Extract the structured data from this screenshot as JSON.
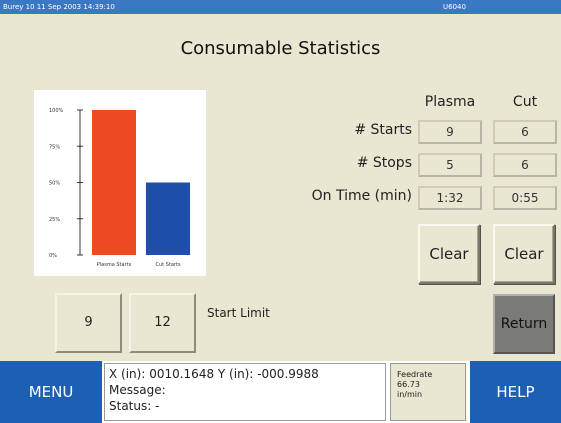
{
  "titlebar": {
    "left": "Burey 10   11 Sep 2003 14:39:10",
    "right": "U6040"
  },
  "page_title": "Consumable Statistics",
  "chart_data": {
    "type": "bar",
    "categories": [
      "Plasma Starts",
      "Cut Starts"
    ],
    "values": [
      100,
      50
    ],
    "colors": [
      "#ee4b22",
      "#1f4faa"
    ],
    "ylim": [
      0,
      100
    ],
    "yticks": [
      "0%",
      "25%",
      "50%",
      "75%",
      "100%"
    ],
    "ytick_values": [
      0,
      25,
      50,
      75,
      100
    ]
  },
  "columns": {
    "plasma": "Plasma",
    "cut": "Cut"
  },
  "rows": [
    {
      "label": "# Starts",
      "plasma": "9",
      "cut": "6"
    },
    {
      "label": "# Stops",
      "plasma": "5",
      "cut": "6"
    },
    {
      "label": "On Time (min)",
      "plasma": "1:32",
      "cut": "0:55"
    }
  ],
  "buttons": {
    "clear_plasma": "Clear",
    "clear_cut": "Clear",
    "return": "Return",
    "menu": "MENU",
    "help": "HELP"
  },
  "limits": {
    "plasma": "9",
    "cut": "12",
    "label": "Start Limit"
  },
  "status": {
    "coords": "X (in): 0010.1648    Y (in): -000.9988",
    "message": "Message:",
    "status": "Status:  -"
  },
  "feedrate": {
    "label": "Feedrate",
    "value": "66.73",
    "unit": "in/min"
  }
}
